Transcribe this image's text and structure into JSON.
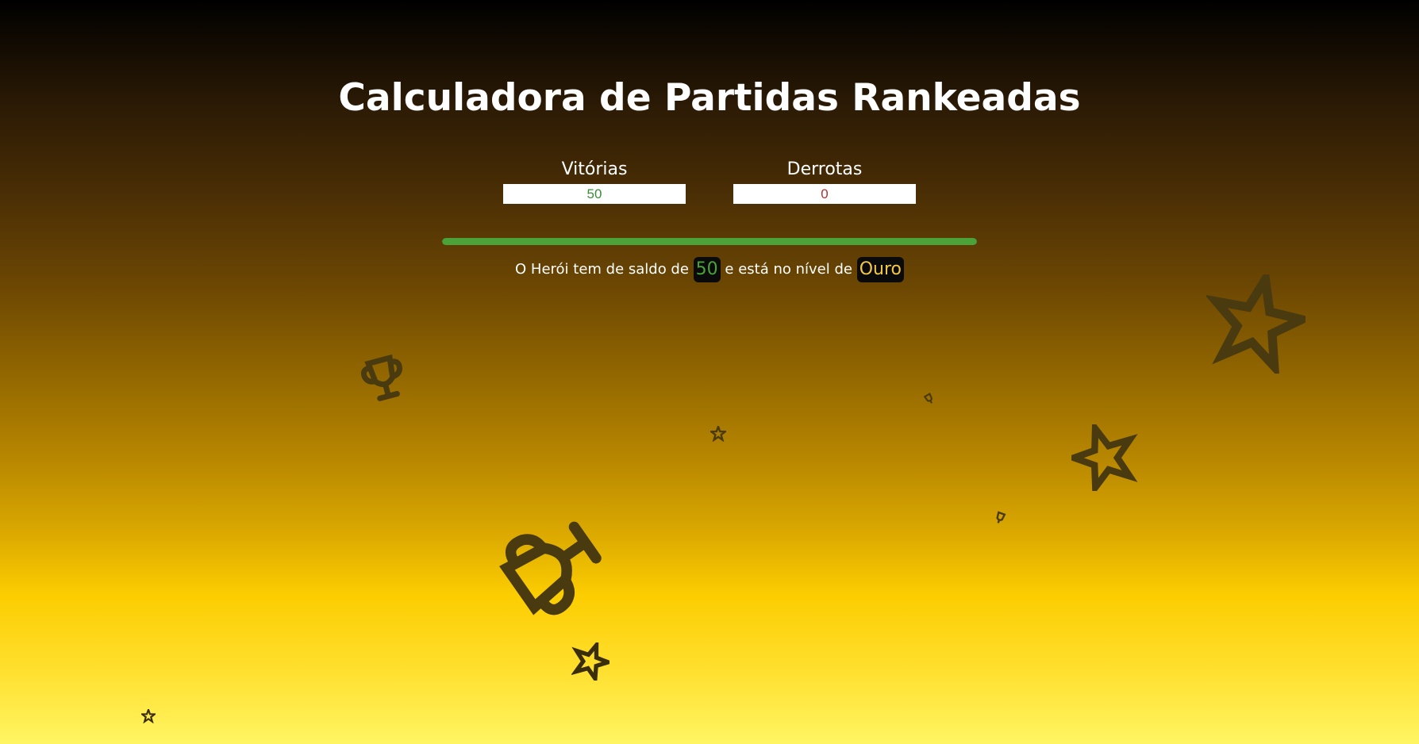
{
  "title": "Calculadora de Partidas Rankeadas",
  "wins": {
    "label": "Vitórias",
    "value": "50"
  },
  "losses": {
    "label": "Derrotas",
    "value": "0"
  },
  "progress": {
    "fraction": 1.0,
    "color": "#4aa238"
  },
  "result": {
    "prefix": "O Herói tem de saldo de",
    "balance": "50",
    "middle": "e está no nível de",
    "level": "Ouro"
  },
  "decorations": {
    "icons": [
      "star-icon",
      "trophy-icon"
    ],
    "color": "#4a3a10"
  },
  "colors": {
    "win_text": "#3d8a3a",
    "loss_text": "#b03030",
    "balance": "#4aa238",
    "level": "#f5c842"
  }
}
